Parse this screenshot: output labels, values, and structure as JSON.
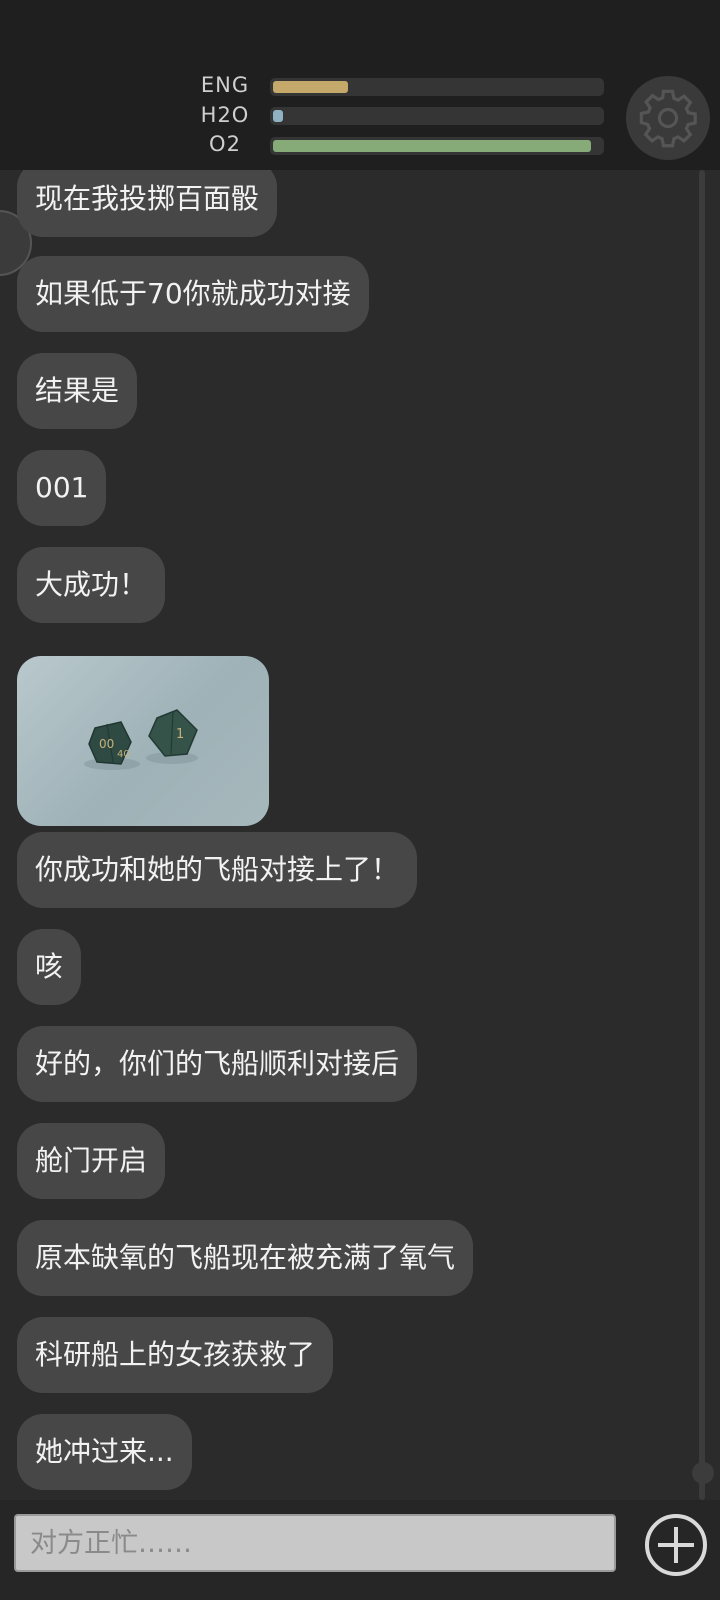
{
  "stats": [
    {
      "label": "ENG",
      "level": 0.23,
      "color": "#c5a96a"
    },
    {
      "label": "H2O",
      "level": 0.03,
      "color": "#8fb1c2"
    },
    {
      "label": "O2",
      "level": 0.97,
      "color": "#86aa78"
    }
  ],
  "settings": {
    "icon": "gear-icon"
  },
  "chat": {
    "messages": [
      "现在我投掷百面骰",
      "如果低于70你就成功对接",
      "结果是",
      "001",
      "大成功！",
      "你成功和她的飞船对接上了！",
      "咳",
      "好的，你们的飞船顺利对接后",
      "舱门开启",
      "原本缺氧的飞船现在被充满了氧气",
      "科研船上的女孩获救了",
      "她冲过来..."
    ],
    "photo": {
      "dice_labels": [
        "00",
        "40",
        "1"
      ]
    }
  },
  "input": {
    "placeholder": "对方正忙……"
  },
  "add_button": {
    "icon": "plus-circle-icon"
  }
}
